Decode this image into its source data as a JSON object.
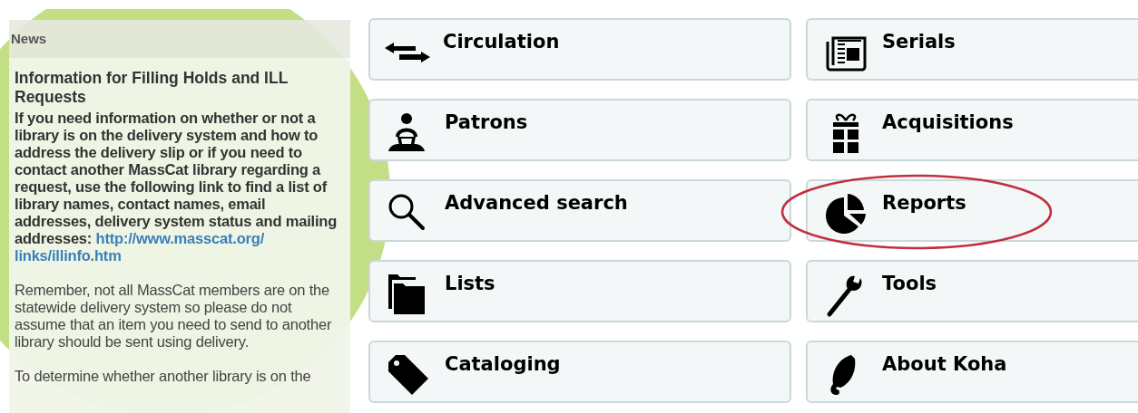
{
  "news": {
    "title": "News",
    "items": [
      {
        "kind": "heading",
        "text": "Information for Filling Holds and ILL Requests"
      },
      {
        "kind": "bold",
        "text": "If you need information on whether or not a library is on the delivery system and how to address the delivery slip or if you need to contact another MassCat library regarding a request, use the following link to find a list of library names, contact names, email addresses, delivery system status and mailing addresses: ",
        "link": "http://www.masscat.org/links/illinfo.htm"
      },
      {
        "kind": "plain",
        "text": "Remember, not all MassCat members are on the statewide delivery system so please do not assume that an item you need to send to another library should be sent using delivery."
      },
      {
        "kind": "plain",
        "text": "To determine whether another library is on the"
      }
    ]
  },
  "modules": [
    {
      "kind": "arrows",
      "label": "Circulation",
      "circled": false
    },
    {
      "kind": "newspaper",
      "label": "Serials",
      "circled": false
    },
    {
      "kind": "reader",
      "label": "Patrons",
      "circled": false
    },
    {
      "kind": "gift",
      "label": "Acquisitions",
      "circled": false
    },
    {
      "kind": "search",
      "label": "Advanced search",
      "circled": false
    },
    {
      "kind": "pie",
      "label": "Reports",
      "circled": true
    },
    {
      "kind": "folders",
      "label": "Lists",
      "circled": false
    },
    {
      "kind": "wrench",
      "label": "Tools",
      "circled": false
    },
    {
      "kind": "tag",
      "label": "Cataloging",
      "circled": false
    },
    {
      "kind": "leaf",
      "label": "About Koha",
      "circled": false
    }
  ]
}
